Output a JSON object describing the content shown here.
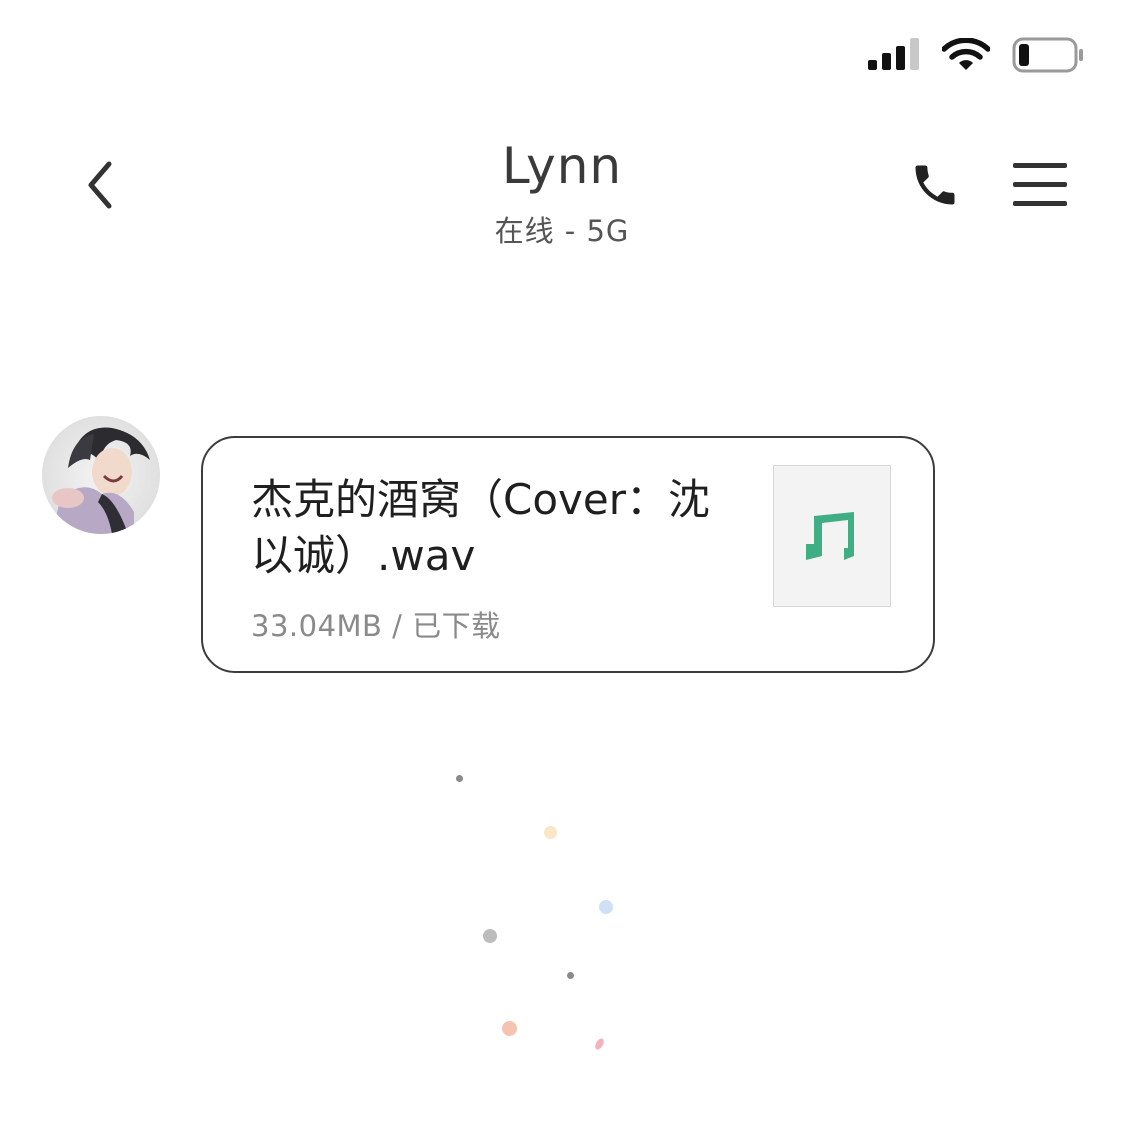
{
  "status_bar": {
    "signal_icon": "cellular-signal-icon",
    "wifi_icon": "wifi-icon",
    "battery_icon": "battery-icon",
    "battery_level": 0.2
  },
  "header": {
    "back_icon": "chevron-left-icon",
    "title": "Lynn",
    "subtitle": "在线 - 5G",
    "call_icon": "phone-icon",
    "menu_icon": "hamburger-menu-icon"
  },
  "message": {
    "avatar": "contact-avatar",
    "file": {
      "name": "杰克的酒窝（Cover：沈以诚）.wav",
      "meta": "33.04MB / 已下载",
      "type_icon": "music-note-icon"
    }
  },
  "colors": {
    "accent_music": "#3fae85",
    "text_primary": "#1f1f1f",
    "text_secondary": "#8a8a8a",
    "bubble_border": "#3c3c3c"
  }
}
